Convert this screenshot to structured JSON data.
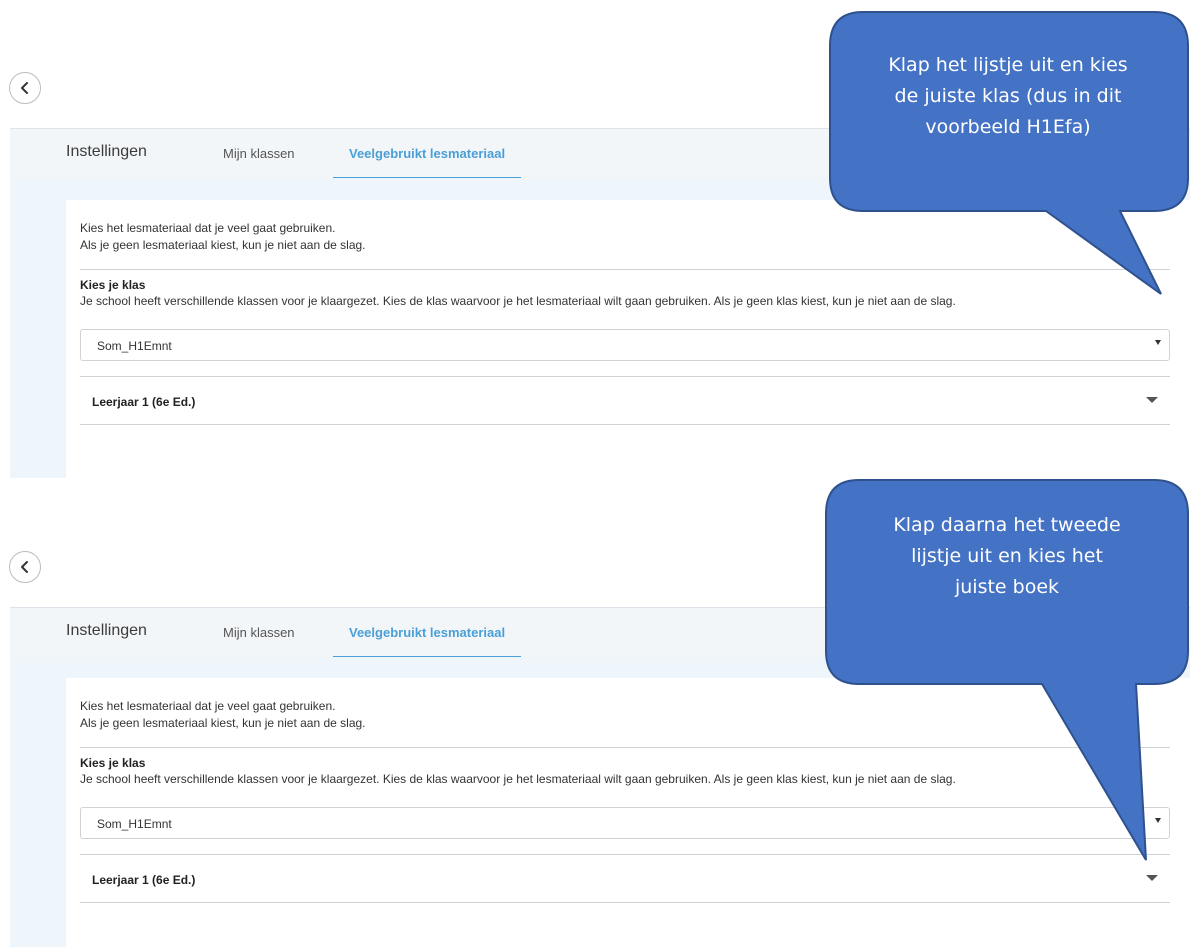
{
  "colors": {
    "accent": "#4a9fd6",
    "callout": "#4472c4",
    "callout_border": "#2f528f"
  },
  "panels": [
    {
      "header": {
        "title": "Instellingen",
        "tabs": [
          "Mijn klassen",
          "Veelgebruikt lesmateriaal"
        ]
      },
      "intro": [
        "Kies het lesmateriaal dat je veel gaat gebruiken.",
        "Als je geen lesmateriaal kiest, kun je niet aan de slag."
      ],
      "class_section": {
        "title": "Kies je klas",
        "description": "Je school heeft verschillende klassen voor je klaargezet. Kies de klas waarvoor je het lesmateriaal wilt gaan gebruiken. Als je geen klas kiest, kun je niet aan de slag.",
        "selected_class": "Som_H1Emnt"
      },
      "book_selector": {
        "label": "Leerjaar 1 (6e Ed.)"
      },
      "callout": {
        "lines": [
          "Klap het lijstje uit en kies",
          "de juiste klas (dus in dit",
          "voorbeeld H1Efa)"
        ]
      }
    },
    {
      "header": {
        "title": "Instellingen",
        "tabs": [
          "Mijn klassen",
          "Veelgebruikt lesmateriaal"
        ]
      },
      "intro": [
        "Kies het lesmateriaal dat je veel gaat gebruiken.",
        "Als je geen lesmateriaal kiest, kun je niet aan de slag."
      ],
      "class_section": {
        "title": "Kies je klas",
        "description": "Je school heeft verschillende klassen voor je klaargezet. Kies de klas waarvoor je het lesmateriaal wilt gaan gebruiken. Als je geen klas kiest, kun je niet aan de slag.",
        "selected_class": "Som_H1Emnt"
      },
      "book_selector": {
        "label": "Leerjaar 1 (6e Ed.)"
      },
      "callout": {
        "lines": [
          "Klap daarna het tweede",
          "lijstje uit en kies het",
          "juiste boek"
        ]
      }
    }
  ]
}
